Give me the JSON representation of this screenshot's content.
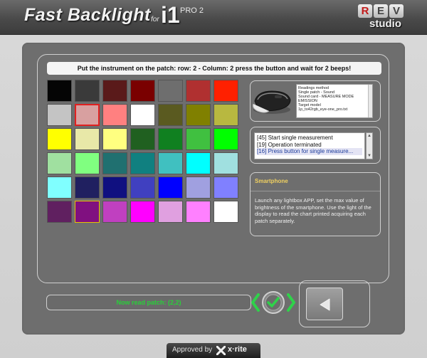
{
  "header": {
    "app_title": "Fast Backlight",
    "for_label": "for",
    "i1_label": "i1",
    "model_label": "PRO 2",
    "brand_letters": [
      "R",
      "E",
      "V"
    ],
    "brand_studio": "studio"
  },
  "instruction": "Put the instrument on the patch: row: 2 - Column: 2 press the button and wait for 2 beeps!",
  "patches": [
    [
      "#050505",
      "#3a3a3a",
      "#5a1a1a",
      "#7a0000",
      "#6e6e6e",
      "#b03030",
      "#ff2000"
    ],
    [
      "#c4c4c4",
      "#d8a0a0",
      "#ff8080",
      "#ffffff",
      "#5a5a20",
      "#808000",
      "#b8b840"
    ],
    [
      "#ffff00",
      "#e8e8a8",
      "#ffff80",
      "#206020",
      "#108020",
      "#40c040",
      "#00ff00"
    ],
    [
      "#a0e0a0",
      "#80ff80",
      "#207070",
      "#108080",
      "#40c0c0",
      "#00ffff",
      "#a0e0e0"
    ],
    [
      "#80ffff",
      "#202060",
      "#101080",
      "#4040c0",
      "#0000ff",
      "#a0a0e0",
      "#8080ff"
    ],
    [
      "#602060",
      "#801080",
      "#c040c0",
      "#ff00ff",
      "#e0a0e0",
      "#ff80ff",
      "#ffffff"
    ]
  ],
  "selected_patch": {
    "row": 2,
    "column": 2
  },
  "settings_list": [
    "Readings method",
    "Single patch - Sound",
    "Sound card - MEASURE MODE",
    "EMISSION",
    "Target model",
    "1p_to42rgb_eye-one_pro.txt"
  ],
  "log": [
    {
      "text": "[45] Start single measurement",
      "selected": false
    },
    {
      "text": "[19] Operation terminated",
      "selected": false
    },
    {
      "text": "[16] Press button for single measure...",
      "selected": true
    }
  ],
  "info": {
    "title": "Smartphone",
    "text": "Launch any lightbox APP, set the max value of brightness of the smartphone. Use the light of the display to read the chart printed acquiring each patch separately."
  },
  "status": "Now read patch: (2,2)",
  "footer": {
    "approved_label": "Approved by",
    "brand": "x·rite"
  },
  "colors": {
    "status_green": "#29d03a",
    "info_title": "#f0d060",
    "confirm_green": "#2fd24a",
    "selected_border": "#e02020"
  },
  "icons": {
    "confirm": "check-icon",
    "back": "triangle-left-icon"
  }
}
